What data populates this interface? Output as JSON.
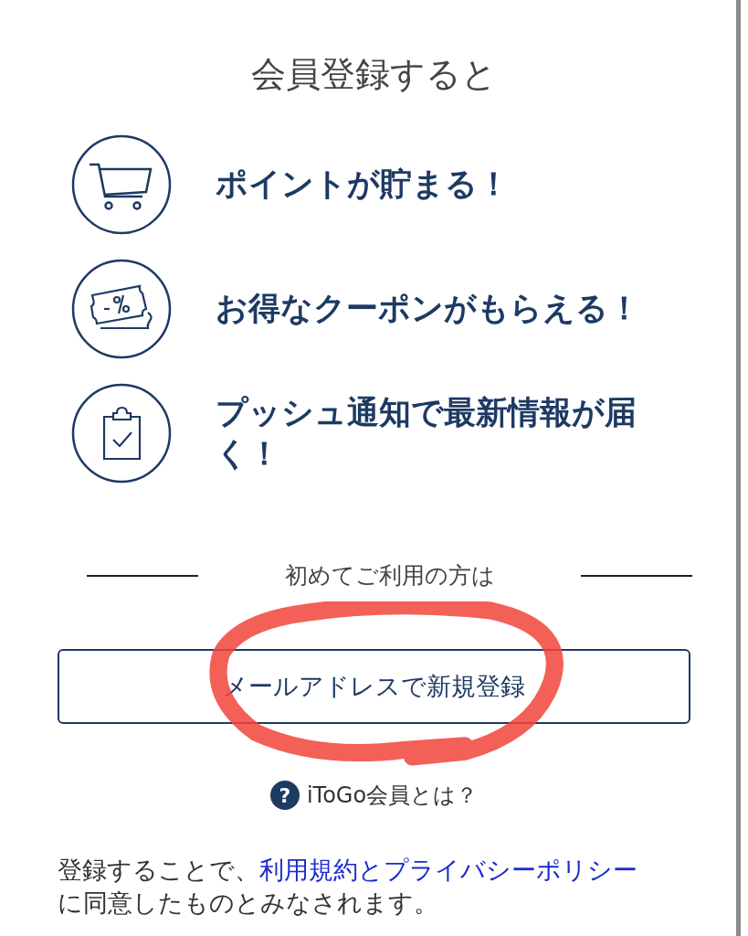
{
  "heading": "会員登録すると",
  "benefits": [
    {
      "kind": "cart",
      "text": "ポイントが貯まる！"
    },
    {
      "kind": "coupon",
      "text": "お得なクーポンがもらえる！"
    },
    {
      "kind": "clipboard",
      "text": "プッシュ通知で最新情報が届く！"
    }
  ],
  "divider_label": "初めてご利用の方は",
  "register_button": "メールアドレスで新規登録",
  "help": {
    "icon": "?",
    "label": "iToGo会員とは？"
  },
  "consent": {
    "before": "登録することで、",
    "link": "利用規約とプライバシーポリシー",
    "after": "に同意したものとみなされます。"
  }
}
